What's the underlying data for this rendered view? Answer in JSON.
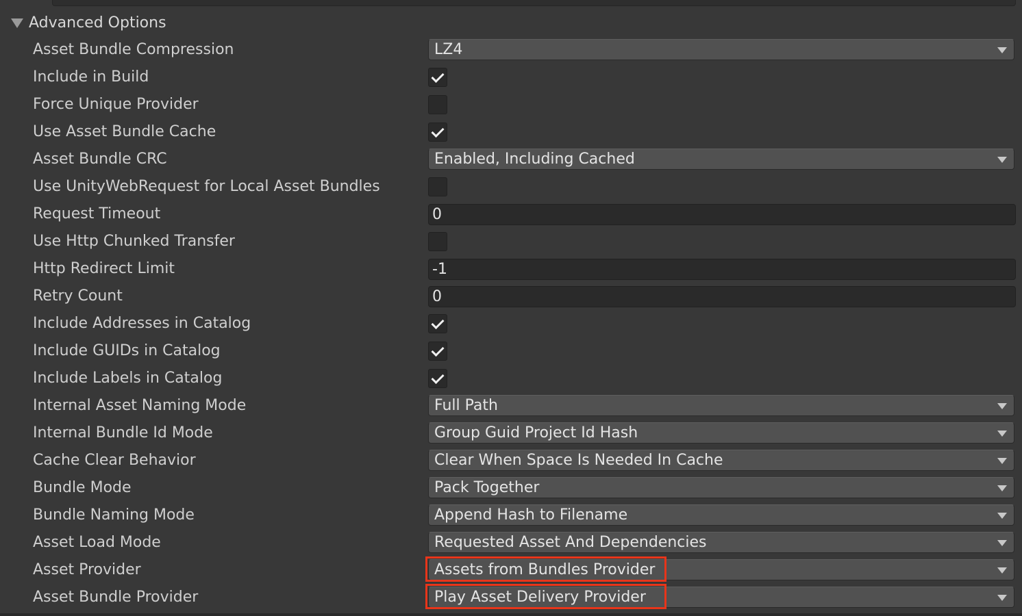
{
  "foldout": {
    "label": "Advanced Options",
    "expanded": true
  },
  "settings": [
    {
      "label": "Asset Bundle Compression",
      "type": "dropdown",
      "value": "LZ4"
    },
    {
      "label": "Include in Build",
      "type": "checkbox",
      "checked": true
    },
    {
      "label": "Force Unique Provider",
      "type": "checkbox",
      "checked": false
    },
    {
      "label": "Use Asset Bundle Cache",
      "type": "checkbox",
      "checked": true
    },
    {
      "label": "Asset Bundle CRC",
      "type": "dropdown",
      "value": "Enabled, Including Cached"
    },
    {
      "label": "Use UnityWebRequest for Local Asset Bundles",
      "type": "checkbox",
      "checked": false
    },
    {
      "label": "Request Timeout",
      "type": "text",
      "value": "0"
    },
    {
      "label": "Use Http Chunked Transfer",
      "type": "checkbox",
      "checked": false
    },
    {
      "label": "Http Redirect Limit",
      "type": "text",
      "value": "-1"
    },
    {
      "label": "Retry Count",
      "type": "text",
      "value": "0"
    },
    {
      "label": "Include Addresses in Catalog",
      "type": "checkbox",
      "checked": true
    },
    {
      "label": "Include GUIDs in Catalog",
      "type": "checkbox",
      "checked": true
    },
    {
      "label": "Include Labels in Catalog",
      "type": "checkbox",
      "checked": true
    },
    {
      "label": "Internal Asset Naming Mode",
      "type": "dropdown",
      "value": "Full Path"
    },
    {
      "label": "Internal Bundle Id Mode",
      "type": "dropdown",
      "value": "Group Guid Project Id Hash"
    },
    {
      "label": "Cache Clear Behavior",
      "type": "dropdown",
      "value": "Clear When Space Is Needed In Cache"
    },
    {
      "label": "Bundle Mode",
      "type": "dropdown",
      "value": "Pack Together"
    },
    {
      "label": "Bundle Naming Mode",
      "type": "dropdown",
      "value": "Append Hash to Filename"
    },
    {
      "label": "Asset Load Mode",
      "type": "dropdown",
      "value": "Requested Asset And Dependencies"
    },
    {
      "label": "Asset Provider",
      "type": "dropdown",
      "value": "Assets from Bundles Provider",
      "highlighted": true
    },
    {
      "label": "Asset Bundle Provider",
      "type": "dropdown",
      "value": "Play Asset Delivery Provider",
      "highlighted": true
    }
  ],
  "colors": {
    "background": "#383838",
    "dropdown": "#515151",
    "field": "#2a2a2a",
    "highlight": "#e8351a"
  }
}
